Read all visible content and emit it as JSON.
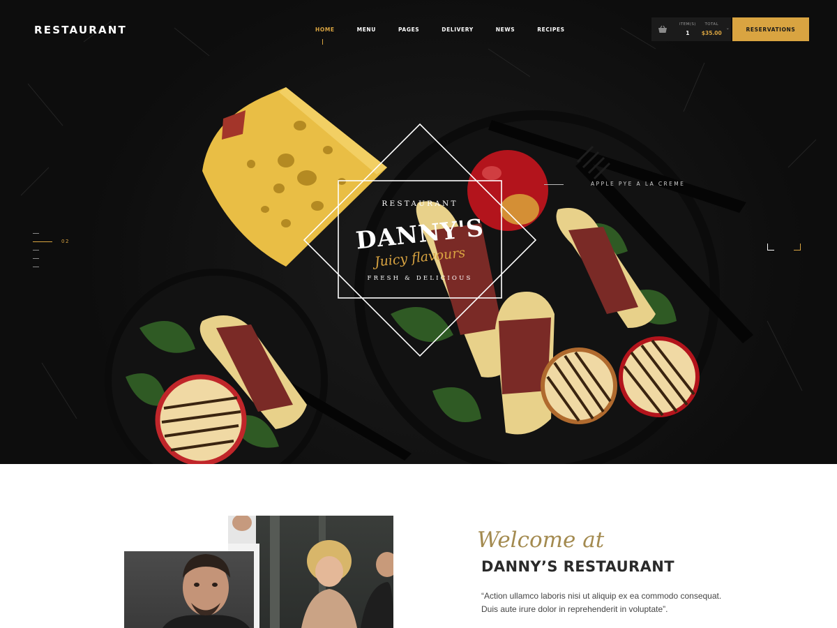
{
  "brand": "RESTAURANT",
  "nav": {
    "items": [
      "HOME",
      "MENU",
      "PAGES",
      "DELIVERY",
      "NEWS",
      "RECIPES"
    ],
    "active": "HOME"
  },
  "cart": {
    "icon": "basket-icon",
    "items_label": "ITEM(S)",
    "items_value": "1",
    "total_label": "TOTAL",
    "total_value": "$35.00"
  },
  "reservations_label": "RESERVATIONS",
  "hero": {
    "slide_number": "02",
    "caption": "APPLE PYE A LA CREME",
    "badge": {
      "top": "RESTAURANT",
      "title": "DANNY'S",
      "script": "Juicy flavours",
      "bottom": "FRESH & DELICIOUS"
    }
  },
  "welcome": {
    "script": "Welcome at",
    "title": "DANNY’S RESTAURANT",
    "quote": "“Action ullamco laboris nisi ut aliquip ex ea commodo consequat. Duis aute irure dolor in reprehenderit in voluptate”."
  },
  "colors": {
    "accent": "#d9a441",
    "hero_bg": "#141414",
    "script_gold": "#a38a4f"
  }
}
